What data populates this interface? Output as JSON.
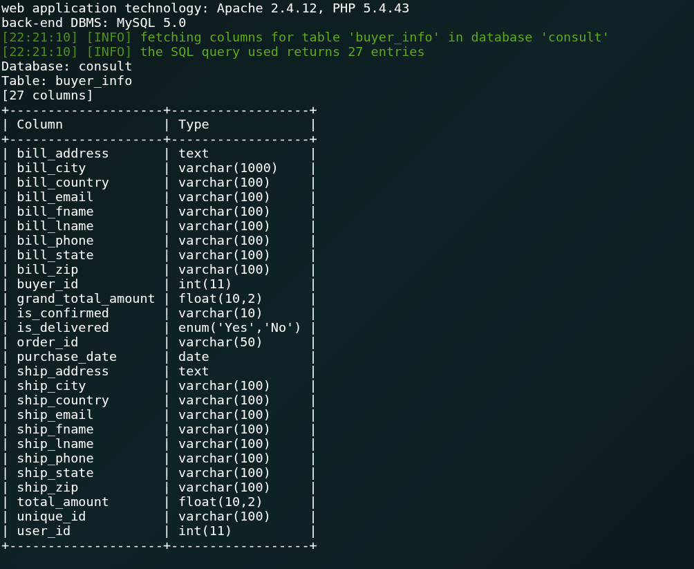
{
  "header_lines": [
    {
      "kind": "plain",
      "text": "web application technology: Apache 2.4.12, PHP 5.4.43"
    },
    {
      "kind": "plain",
      "text": "back-end DBMS: MySQL 5.0"
    },
    {
      "kind": "log",
      "time": "[22:21:10]",
      "level": "[INFO]",
      "message": "fetching columns for table 'buyer_info' in database 'consult'"
    },
    {
      "kind": "log",
      "time": "[22:21:10]",
      "level": "[INFO]",
      "message": "the SQL query used returns 27 entries"
    },
    {
      "kind": "plain",
      "text": "Database: consult"
    },
    {
      "kind": "plain",
      "text": "Table: buyer_info"
    },
    {
      "kind": "plain",
      "text": "[27 columns]"
    }
  ],
  "table": {
    "rule": "+--------------------+------------------+",
    "separator": "|",
    "columns": [
      "Column",
      "Type"
    ],
    "rows": [
      [
        "bill_address",
        "text"
      ],
      [
        "bill_city",
        "varchar(1000)"
      ],
      [
        "bill_country",
        "varchar(100)"
      ],
      [
        "bill_email",
        "varchar(100)"
      ],
      [
        "bill_fname",
        "varchar(100)"
      ],
      [
        "bill_lname",
        "varchar(100)"
      ],
      [
        "bill_phone",
        "varchar(100)"
      ],
      [
        "bill_state",
        "varchar(100)"
      ],
      [
        "bill_zip",
        "varchar(100)"
      ],
      [
        "buyer_id",
        "int(11)"
      ],
      [
        "grand_total_amount",
        "float(10,2)"
      ],
      [
        "is_confirmed",
        "varchar(10)"
      ],
      [
        "is_delivered",
        "enum('Yes','No')"
      ],
      [
        "order_id",
        "varchar(50)"
      ],
      [
        "purchase_date",
        "date"
      ],
      [
        "ship_address",
        "text"
      ],
      [
        "ship_city",
        "varchar(100)"
      ],
      [
        "ship_country",
        "varchar(100)"
      ],
      [
        "ship_email",
        "varchar(100)"
      ],
      [
        "ship_fname",
        "varchar(100)"
      ],
      [
        "ship_lname",
        "varchar(100)"
      ],
      [
        "ship_phone",
        "varchar(100)"
      ],
      [
        "ship_state",
        "varchar(100)"
      ],
      [
        "ship_zip",
        "varchar(100)"
      ],
      [
        "total_amount",
        "float(10,2)"
      ],
      [
        "unique_id",
        "varchar(100)"
      ],
      [
        "user_id",
        "int(11)"
      ]
    ]
  }
}
